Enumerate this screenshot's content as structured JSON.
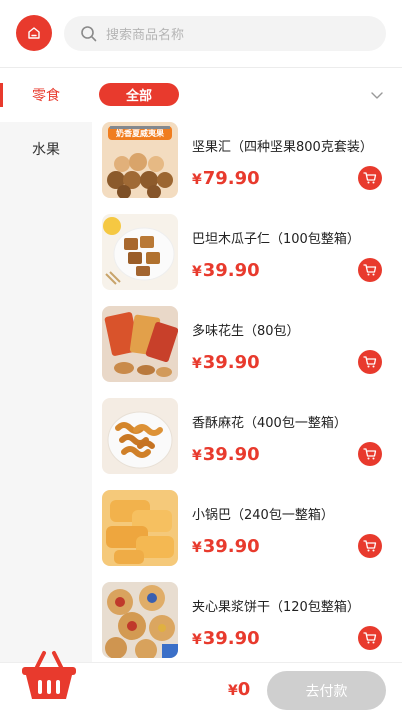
{
  "header": {
    "home_icon": "home-icon",
    "search": {
      "placeholder": "搜索商品名称",
      "icon": "search-icon"
    }
  },
  "sidebar": {
    "items": [
      {
        "label": "零食",
        "active": true
      },
      {
        "label": "水果",
        "active": false
      }
    ]
  },
  "filter": {
    "all_label": "全部",
    "expand_icon": "chevron-down-icon"
  },
  "products": [
    {
      "name": "坚果汇（四种坚果800克套装）",
      "currency": "¥",
      "price": "79.90",
      "banner_text": "奶香夏威夷果"
    },
    {
      "name": "巴坦木瓜子仁（100包整箱）",
      "currency": "¥",
      "price": "39.90"
    },
    {
      "name": "多味花生（80包）",
      "currency": "¥",
      "price": "39.90"
    },
    {
      "name": "香酥麻花（400包一整箱）",
      "currency": "¥",
      "price": "39.90"
    },
    {
      "name": "小锅巴（240包一整箱）",
      "currency": "¥",
      "price": "39.90"
    },
    {
      "name": "夹心果浆饼干（120包整箱）",
      "currency": "¥",
      "price": "39.90"
    }
  ],
  "footer": {
    "currency": "¥",
    "total": "0",
    "pay_label": "去付款",
    "basket_icon": "shopping-basket-icon"
  },
  "colors": {
    "accent": "#e83a2d",
    "disabled": "#cfcfcf"
  }
}
